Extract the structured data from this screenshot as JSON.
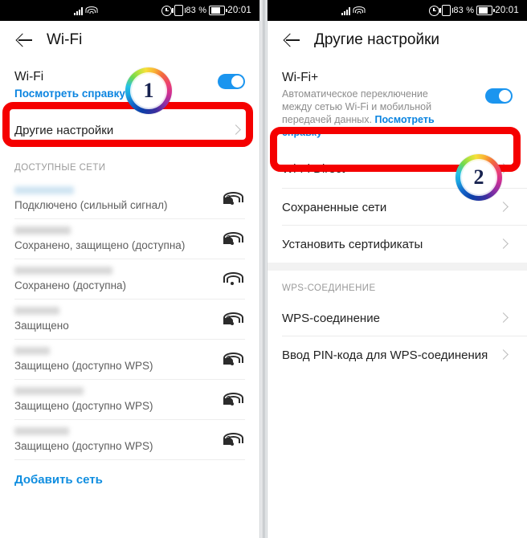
{
  "statusbar": {
    "battery_percent": "83 %",
    "clock": "20:01",
    "icons": [
      "signal-bars-icon",
      "wifi-icon",
      "alarm-icon",
      "vibrate-icon",
      "battery-icon"
    ]
  },
  "left_panel": {
    "title": "Wi-Fi",
    "back_icon": "back-arrow-icon",
    "wifi_master": {
      "label": "Wi-Fi",
      "help_link": "Посмотреть справку",
      "toggle_on": true
    },
    "other_settings_row": "Другие настройки",
    "available_section": "ДОСТУПНЫЕ СЕТИ",
    "networks": [
      {
        "ssid_redacted": true,
        "ssid_width": 74,
        "ssid_color": "#cfe4f2",
        "status": "Подключено (сильный сигнал)",
        "secured": true
      },
      {
        "ssid_redacted": true,
        "ssid_width": 70,
        "ssid_color": "#d6d6d6",
        "status": "Сохранено, защищено (доступна)",
        "secured": true
      },
      {
        "ssid_redacted": true,
        "ssid_width": 122,
        "ssid_color": "#d8d8d8",
        "status": "Сохранено (доступна)",
        "secured": false
      },
      {
        "ssid_redacted": true,
        "ssid_width": 56,
        "ssid_color": "#d8d8d8",
        "status": "Защищено",
        "secured": true
      },
      {
        "ssid_redacted": true,
        "ssid_width": 44,
        "ssid_color": "#d8d8d8",
        "status": "Защищено (доступно WPS)",
        "secured": true
      },
      {
        "ssid_redacted": true,
        "ssid_width": 86,
        "ssid_color": "#d8d8d8",
        "status": "Защищено (доступно WPS)",
        "secured": true
      },
      {
        "ssid_redacted": true,
        "ssid_width": 68,
        "ssid_color": "#d8d8d8",
        "status": "Защищено (доступно WPS)",
        "secured": true
      }
    ],
    "add_network": "Добавить сеть"
  },
  "right_panel": {
    "title": "Другие настройки",
    "back_icon": "back-arrow-icon",
    "wifi_plus": {
      "label": "Wi-Fi+",
      "description": "Автоматическое переключение между сетью Wi-Fi и мобильной передачей данных. ",
      "help_link": "Посмотреть справку",
      "toggle_on": true
    },
    "rows": [
      {
        "label": "Wi-Fi Direct"
      },
      {
        "label": "Сохраненные сети"
      },
      {
        "label": "Установить сертификаты"
      }
    ],
    "wps_section": "WPS-СОЕДИНЕНИЕ",
    "wps_rows": [
      {
        "label": "WPS-соединение"
      },
      {
        "label": "Ввод PIN-кода для WPS-соединения"
      }
    ]
  },
  "annotations": {
    "badges": [
      {
        "number": "1"
      },
      {
        "number": "2"
      }
    ],
    "highlight_color": "#f50000"
  },
  "colors": {
    "accent_blue": "#0a84e0",
    "toggle_blue": "#1b95ef",
    "highlight_red": "#f50000",
    "status_text": "#5e5e5e"
  }
}
